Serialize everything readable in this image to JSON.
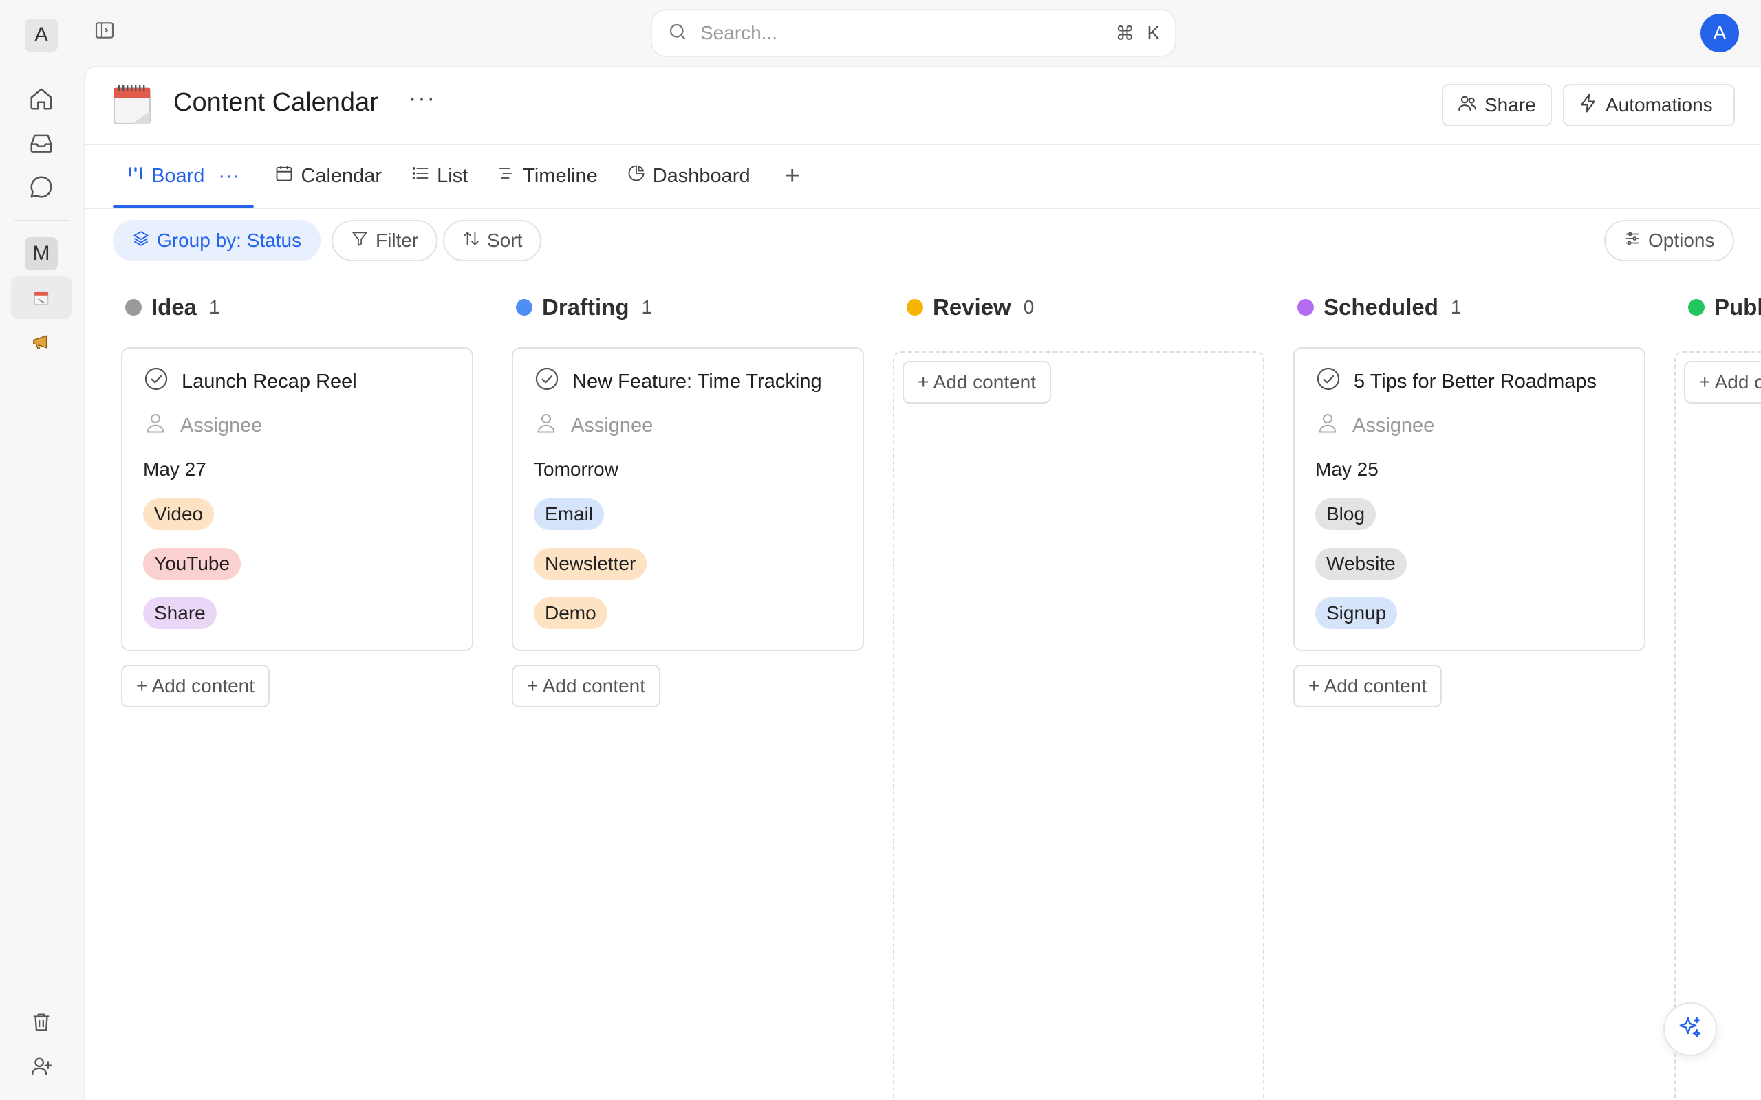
{
  "workspace": {
    "badge": "A",
    "second_badge": "M"
  },
  "search": {
    "placeholder": "Search...",
    "shortcut_symbol": "⌘",
    "shortcut_key": "K"
  },
  "user": {
    "avatar_initial": "A"
  },
  "page": {
    "title": "Content Calendar",
    "more": "···"
  },
  "header_buttons": {
    "share": "Share",
    "automations": "Automations"
  },
  "tabs": [
    {
      "label": "Board",
      "more": "···",
      "active": true
    },
    {
      "label": "Calendar"
    },
    {
      "label": "List"
    },
    {
      "label": "Timeline"
    },
    {
      "label": "Dashboard"
    }
  ],
  "tab_add": "+",
  "toolbar": {
    "group_by": "Group by: Status",
    "filter": "Filter",
    "sort": "Sort",
    "options": "Options"
  },
  "columns": [
    {
      "name": "Idea",
      "count": "1",
      "color": "#9a9a9a"
    },
    {
      "name": "Drafting",
      "count": "1",
      "color": "#4f8ef5"
    },
    {
      "name": "Review",
      "count": "0",
      "color": "#f5b400"
    },
    {
      "name": "Scheduled",
      "count": "1",
      "color": "#b46cf0"
    },
    {
      "name": "Publ",
      "count": "",
      "color": "#22c55e"
    }
  ],
  "cards": [
    {
      "title": "Launch Recap Reel",
      "assignee": "Assignee",
      "date": "May 27",
      "tags": [
        {
          "label": "Video",
          "bg": "#fde2c4"
        },
        {
          "label": "YouTube",
          "bg": "#fbd0d0"
        },
        {
          "label": "Share",
          "bg": "#ead7f7"
        }
      ]
    },
    {
      "title": "New Feature: Time Tracking",
      "assignee": "Assignee",
      "date": "Tomorrow",
      "tags": [
        {
          "label": "Email",
          "bg": "#d6e4fb"
        },
        {
          "label": "Newsletter",
          "bg": "#fde2c4"
        },
        {
          "label": "Demo",
          "bg": "#fde2c4"
        }
      ]
    },
    {
      "title": "5 Tips for Better Roadmaps",
      "assignee": "Assignee",
      "date": "May 25",
      "tags": [
        {
          "label": "Blog",
          "bg": "#e3e3e3"
        },
        {
          "label": "Website",
          "bg": "#e3e3e3"
        },
        {
          "label": "Signup",
          "bg": "#d6e4fb"
        }
      ]
    }
  ],
  "add_content": "+ Add content",
  "add_content_partial": "+ Add c"
}
